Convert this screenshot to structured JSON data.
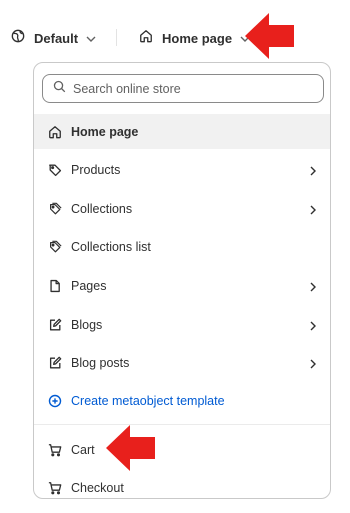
{
  "header": {
    "theme_label": "Default",
    "page_label": "Home page"
  },
  "search": {
    "placeholder": "Search online store"
  },
  "menu": {
    "items": [
      {
        "label": "Home page",
        "icon": "home-icon",
        "selected": true,
        "has_submenu": false
      },
      {
        "label": "Products",
        "icon": "tag-icon",
        "has_submenu": true
      },
      {
        "label": "Collections",
        "icon": "collections-icon",
        "has_submenu": true
      },
      {
        "label": "Collections list",
        "icon": "collections-icon",
        "has_submenu": false
      },
      {
        "label": "Pages",
        "icon": "page-icon",
        "has_submenu": true
      },
      {
        "label": "Blogs",
        "icon": "blog-icon",
        "has_submenu": true
      },
      {
        "label": "Blog posts",
        "icon": "blog-icon",
        "has_submenu": true
      },
      {
        "label": "Create metaobject template",
        "icon": "plus-circle-icon",
        "link": true
      },
      {
        "label": "Cart",
        "icon": "cart-icon",
        "has_submenu": false
      },
      {
        "label": "Checkout",
        "icon": "cart-icon",
        "has_submenu": false
      }
    ]
  },
  "colors": {
    "annotation_arrow": "#e8201c",
    "link": "#005bd3",
    "selected_bg": "#f1f1f1"
  }
}
